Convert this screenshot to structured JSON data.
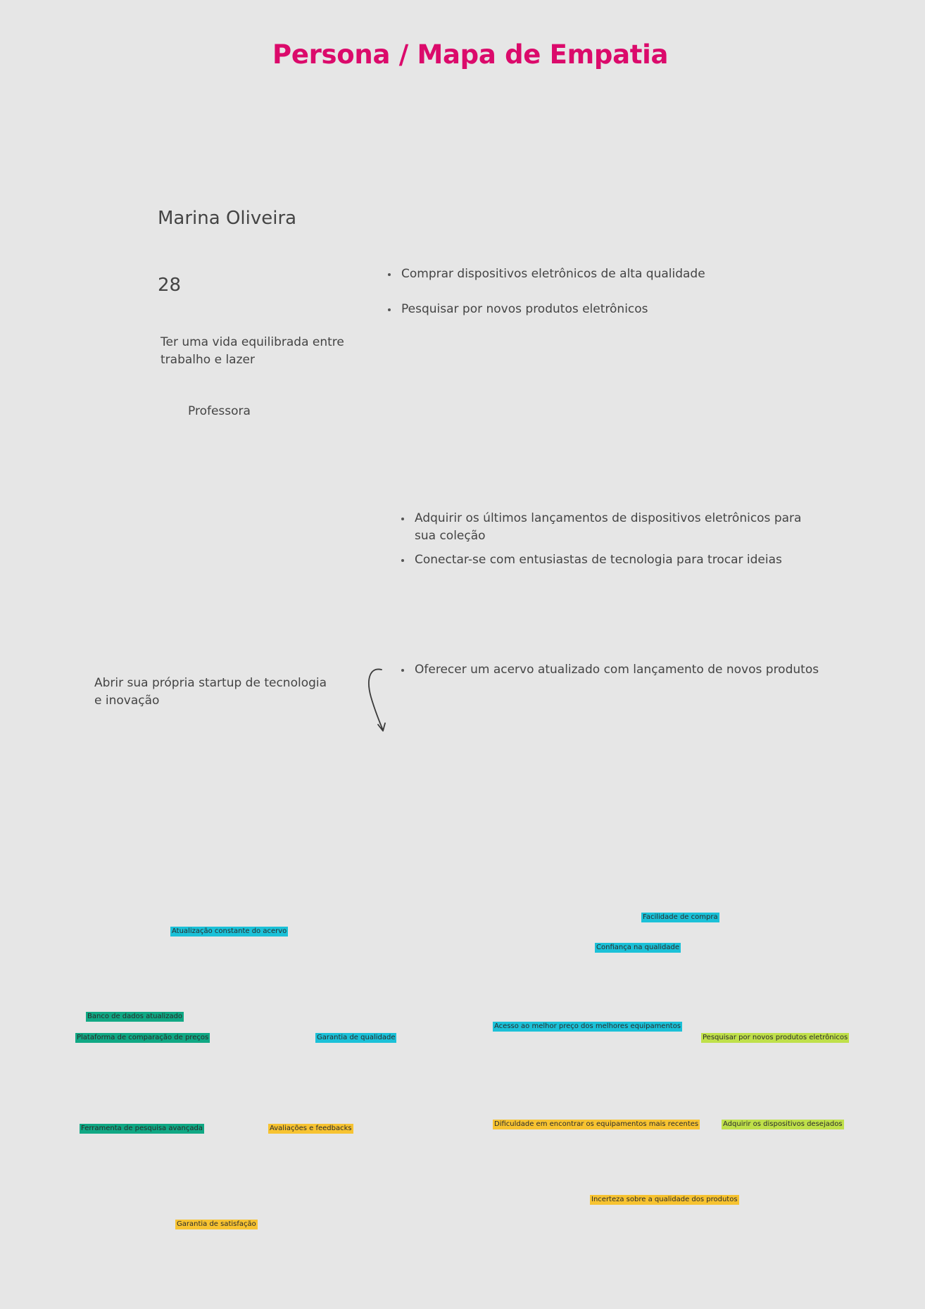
{
  "title": "Persona / Mapa de Empatia",
  "persona": {
    "name": "Marina Oliveira",
    "age": "28",
    "goal": "Ter uma vida equilibrada entre trabalho e lazer",
    "occupation": "Professora",
    "dream": "Abrir sua própria startup de tecnologia e inovação"
  },
  "lists": {
    "behaviors": [
      "Comprar dispositivos eletrônicos de alta qualidade",
      "Pesquisar por novos produtos eletrônicos"
    ],
    "desires": [
      "Adquirir os últimos lançamentos de dispositivos eletrônicos para sua coleção",
      "Conectar-se com entusiastas de tecnologia para trocar ideias"
    ],
    "offer": [
      "Oferecer um acervo atualizado com lançamento de novos produtos"
    ]
  },
  "stickies": {
    "atualizacao": "Atualização constante do acervo",
    "facilidade": "Facilidade de compra",
    "confianca": "Confiança na qualidade",
    "banco": "Banco de dados atualizado",
    "plataforma": "Plataforma de comparação de preços",
    "garantia_qualidade": "Garantia de qualidade",
    "acesso": "Acesso ao melhor preço dos melhores equipamentos",
    "pesquisar": "Pesquisar por novos produtos eletrônicos",
    "ferramenta": "Ferramenta de pesquisa avançada",
    "avaliacoes": "Avaliações e feedbacks",
    "dificuldade": "Dificuldade em encontrar os equipamentos mais recentes",
    "adquirir": "Adquirir os dispositivos desejados",
    "incerteza": "Incerteza sobre a qualidade dos produtos",
    "garantia_satisfacao": "Garantia de satisfação"
  },
  "colors": {
    "title": "#db0a6b",
    "teal": "#1bc1d8",
    "green": "#10a884",
    "yellow": "#f7c331",
    "lime": "#bfe04a",
    "background": "#e6e6e6"
  },
  "icons": {
    "connector": "curved-arrow-icon"
  }
}
